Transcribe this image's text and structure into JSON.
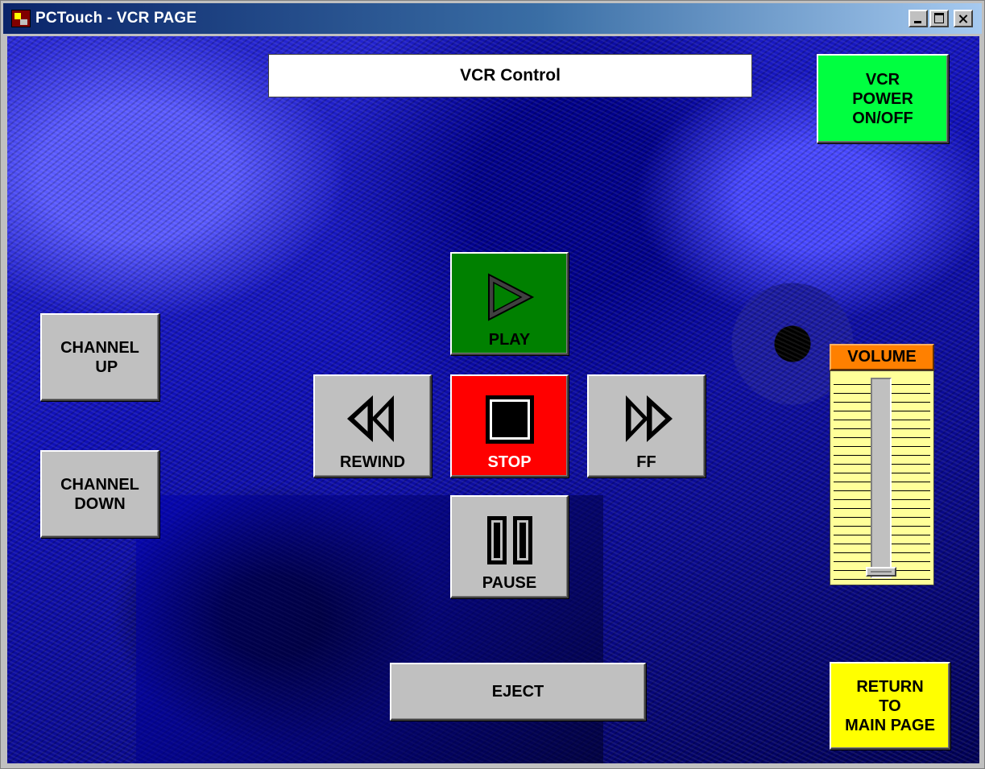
{
  "window": {
    "title": "PCTouch - VCR PAGE"
  },
  "header": {
    "title": "VCR Control"
  },
  "buttons": {
    "power": "VCR\nPOWER\nON/OFF",
    "play": "PLAY",
    "stop": "STOP",
    "rewind": "REWIND",
    "ff": "FF",
    "pause": "PAUSE",
    "channel_up": "CHANNEL\n   UP",
    "channel_down": "CHANNEL\nDOWN",
    "eject": "EJECT",
    "return": "RETURN\nTO\nMAIN PAGE"
  },
  "volume": {
    "label": "VOLUME",
    "level": 0.0
  },
  "colors": {
    "power": "#00ff40",
    "play": "#008000",
    "stop": "#ff0000",
    "return": "#ffff00",
    "volume_label": "#ff8000",
    "volume_scale": "#ffff99"
  },
  "icons": {
    "play": "play-triangle-icon",
    "stop": "stop-square-icon",
    "rewind": "rewind-icon",
    "ff": "fast-forward-icon",
    "pause": "pause-icon"
  }
}
